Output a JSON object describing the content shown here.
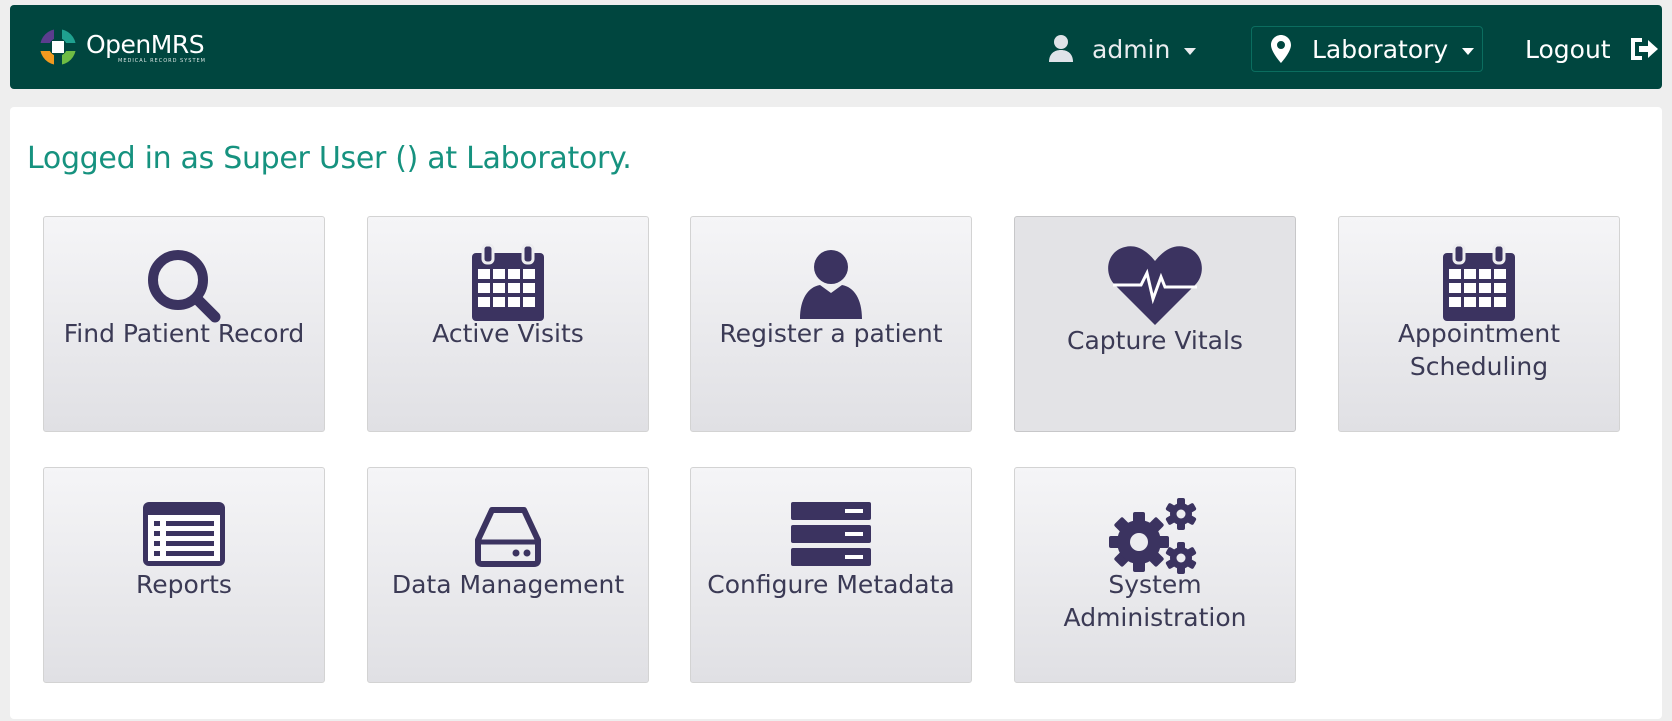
{
  "header": {
    "brand": "OpenMRS",
    "brand_sub": "MEDICAL RECORD SYSTEM",
    "user": "admin",
    "location": "Laboratory",
    "logout": "Logout"
  },
  "main": {
    "welcome": "Logged in as Super User () at Laboratory."
  },
  "tiles": [
    {
      "label": "Find Patient Record",
      "icon": "search-icon"
    },
    {
      "label": "Active Visits",
      "icon": "calendar-icon"
    },
    {
      "label": "Register a patient",
      "icon": "user-icon"
    },
    {
      "label": "Capture Vitals",
      "icon": "heartbeat-icon"
    },
    {
      "label": "Appointment\nScheduling",
      "icon": "calendar-icon"
    },
    {
      "label": "Reports",
      "icon": "list-alt-icon"
    },
    {
      "label": "Data Management",
      "icon": "hdd-icon"
    },
    {
      "label": "Configure Metadata",
      "icon": "server-icon"
    },
    {
      "label": "System\nAdministration",
      "icon": "cogs-icon"
    }
  ],
  "colors": {
    "header_bg": "#00463f",
    "accent_text": "#16927f",
    "icon": "#3b3360",
    "tile_label": "#3b3a55"
  }
}
